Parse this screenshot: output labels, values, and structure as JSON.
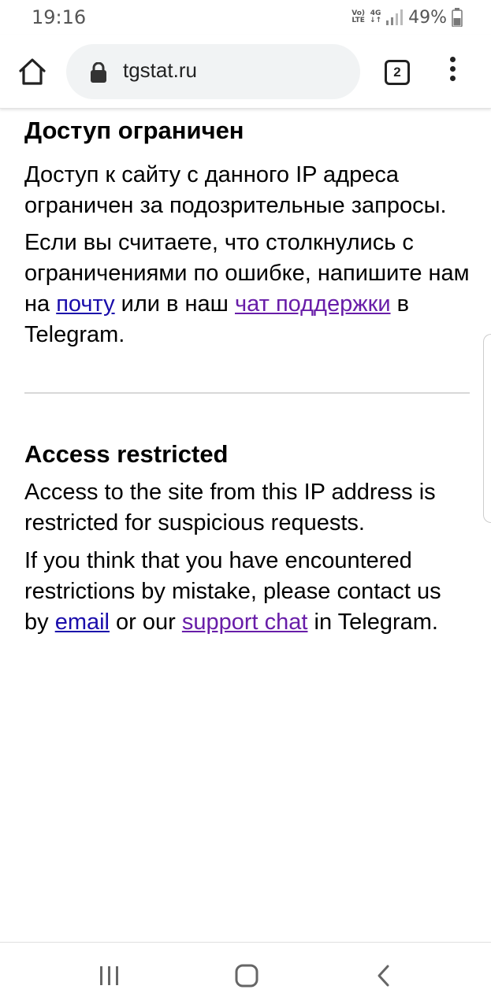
{
  "status": {
    "time": "19:16",
    "network_top": "Vo)) LTE",
    "network_4g": "4G",
    "battery": "49%"
  },
  "toolbar": {
    "url": "tgstat.ru",
    "tab_count": "2"
  },
  "ru": {
    "heading": "Доступ ограничен",
    "para1": "Доступ к сайту с данного IP адреса ограничен за подозрительные запросы.",
    "para2_a": "Если вы считаете, что столкнулись с ограничениями по ошибке, напишите нам на ",
    "link_email": "почту",
    "para2_b": " или в наш ",
    "link_chat": "чат поддержки",
    "para2_c": " в Telegram."
  },
  "en": {
    "heading": "Access restricted",
    "para1": "Access to the site from this IP address is restricted for suspicious requests.",
    "para2_a": "If you think that you have encountered restrictions by mistake, please contact us by ",
    "link_email": "email",
    "para2_b": " or our ",
    "link_chat": "support chat",
    "para2_c": " in Telegram."
  },
  "colors": {
    "link": "#1a0dab",
    "link_visited": "#681da8",
    "url_pill": "#f1f3f4"
  },
  "icons": [
    "home-icon",
    "lock-icon",
    "tabs-icon",
    "more-vert-icon",
    "recent-apps-icon",
    "home-nav-icon",
    "back-icon",
    "signal-icon",
    "battery-icon"
  ]
}
